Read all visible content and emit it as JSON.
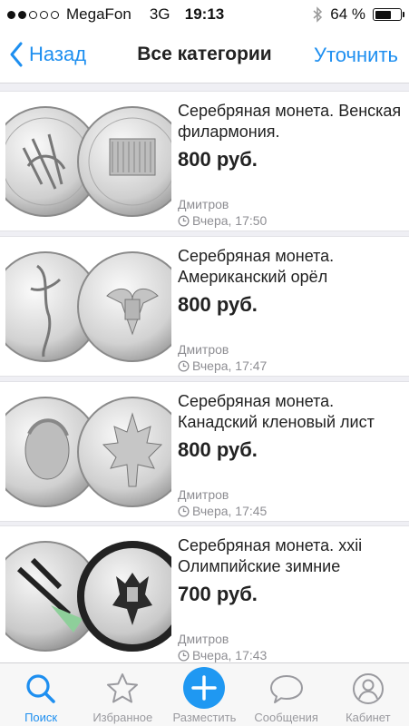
{
  "status_bar": {
    "carrier": "MegaFon",
    "network": "3G",
    "time": "19:13",
    "battery_text": "64 %",
    "battery_level": 0.64,
    "signal_bars": 2
  },
  "nav": {
    "back_label": "Назад",
    "title": "Все категории",
    "action_label": "Уточнить"
  },
  "items": [
    {
      "title": "Серебряная монета. Венская филармония.",
      "price": "800 руб.",
      "city": "Дмитров",
      "time": "Вчера, 17:50"
    },
    {
      "title": "Серебряная монета. Американский орёл",
      "price": "800 руб.",
      "city": "Дмитров",
      "time": "Вчера, 17:47"
    },
    {
      "title": "Серебряная монета. Канадский кленовый лист",
      "price": "800 руб.",
      "city": "Дмитров",
      "time": "Вчера, 17:45"
    },
    {
      "title": "Серебряная монета. xxii Олимпийские зимние",
      "price": "700 руб.",
      "city": "Дмитров",
      "time": "Вчера, 17:43"
    }
  ],
  "tabs": [
    {
      "label": "Поиск",
      "icon": "search-icon",
      "active": true
    },
    {
      "label": "Избранное",
      "icon": "star-icon",
      "active": false
    },
    {
      "label": "Разместить",
      "icon": "plus-icon",
      "active": false
    },
    {
      "label": "Сообщения",
      "icon": "speech-bubble-icon",
      "active": false
    },
    {
      "label": "Кабинет",
      "icon": "person-icon",
      "active": false
    }
  ],
  "colors": {
    "accent": "#1e8ff0",
    "muted": "#8e8e93"
  }
}
